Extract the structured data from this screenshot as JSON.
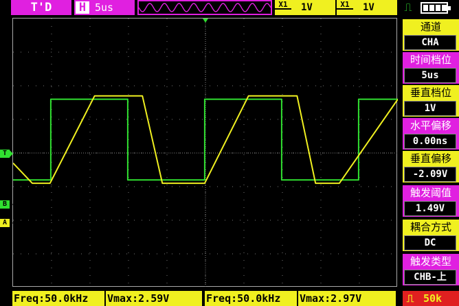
{
  "topbar": {
    "mode": "T'D",
    "timebase_prefix": "H",
    "timebase": "5us",
    "ch1": {
      "prefix": "X1",
      "volts": "1V"
    },
    "ch2": {
      "prefix": "X1",
      "volts": "1V"
    }
  },
  "markers": {
    "trigger": "T",
    "channel_b": "B",
    "channel_a": "A"
  },
  "menu": [
    {
      "title": "通道",
      "value": "CHA",
      "style": "yel"
    },
    {
      "title": "时间档位",
      "value": "5us",
      "style": "mag"
    },
    {
      "title": "垂直档位",
      "value": "1V",
      "style": "yel"
    },
    {
      "title": "水平偏移",
      "value": "0.00ns",
      "style": "mag"
    },
    {
      "title": "垂直偏移",
      "value": "-2.09V",
      "style": "yel"
    },
    {
      "title": "触发阈值",
      "value": "1.49V",
      "style": "mag"
    },
    {
      "title": "耦合方式",
      "value": "DC",
      "style": "yel"
    },
    {
      "title": "触发类型",
      "value": "CHB-上",
      "style": "mag"
    }
  ],
  "bottom": {
    "cha_freq": "Freq:50.0kHz",
    "cha_vmax": "Vmax:2.59V",
    "chb_freq": "Freq:50.0kHz",
    "chb_vmax": "Vmax:2.97V",
    "sample_rate": "50k"
  },
  "colors": {
    "cha": "#f0f020",
    "chb": "#30e030",
    "accent": "#e020e0"
  },
  "chart_data": {
    "type": "line",
    "title": "",
    "xlabel": "",
    "ylabel": "",
    "x_unit": "us",
    "y_unit": "V",
    "grid": true,
    "series": [
      {
        "name": "",
        "channel": "A",
        "x": [
          0,
          2.5,
          4.8,
          10.6,
          12.8,
          16.8,
          19.4,
          22.5,
          24.9,
          30.6,
          32.6,
          36.9,
          39.3,
          42.4,
          50
        ],
        "values": [
          0.6,
          0.0,
          0.0,
          2.6,
          2.6,
          2.6,
          0.0,
          0.0,
          0.0,
          2.6,
          2.6,
          2.6,
          0.0,
          0.0,
          2.5
        ]
      },
      {
        "name": "",
        "channel": "B",
        "x": [
          0,
          4.9,
          4.9,
          14.9,
          14.9,
          24.9,
          24.9,
          34.9,
          34.9,
          44.9,
          44.9,
          50
        ],
        "values": [
          0.6,
          0.6,
          3.0,
          3.0,
          0.6,
          0.6,
          3.0,
          3.0,
          0.6,
          0.6,
          3.0,
          3.0
        ]
      }
    ]
  }
}
